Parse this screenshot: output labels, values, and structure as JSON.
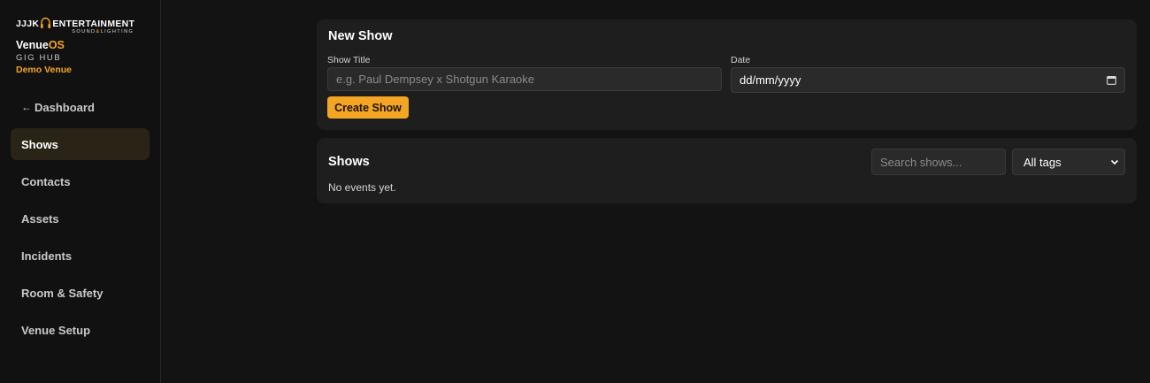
{
  "brand": {
    "logo_left": "JJJK",
    "logo_right": "ENTERTAINMENT",
    "logo_sub_1": "SOUND",
    "logo_sub_amp": "&",
    "logo_sub_2": "LIGHTING",
    "app_name_1": "Venue",
    "app_name_2": "OS",
    "app_subtitle": "GIG HUB",
    "venue_name": "Demo Venue"
  },
  "nav": {
    "back_arrow": "←",
    "back_label": "Dashboard",
    "items": [
      {
        "label": "Shows",
        "active": true
      },
      {
        "label": "Contacts",
        "active": false
      },
      {
        "label": "Assets",
        "active": false
      },
      {
        "label": "Incidents",
        "active": false
      },
      {
        "label": "Room & Safety",
        "active": false
      },
      {
        "label": "Venue Setup",
        "active": false
      }
    ]
  },
  "new_show": {
    "title": "New Show",
    "title_label": "Show Title",
    "title_placeholder": "e.g. Paul Dempsey x Shotgun Karaoke",
    "date_label": "Date",
    "date_value": "dd/mm/yyyy",
    "create_label": "Create Show"
  },
  "shows": {
    "title": "Shows",
    "search_placeholder": "Search shows...",
    "tag_filter": "All tags",
    "empty_message": "No events yet."
  },
  "colors": {
    "accent": "#f5a524",
    "background": "#131313",
    "card": "#1e1e1e",
    "active_nav": "#2a2416"
  }
}
